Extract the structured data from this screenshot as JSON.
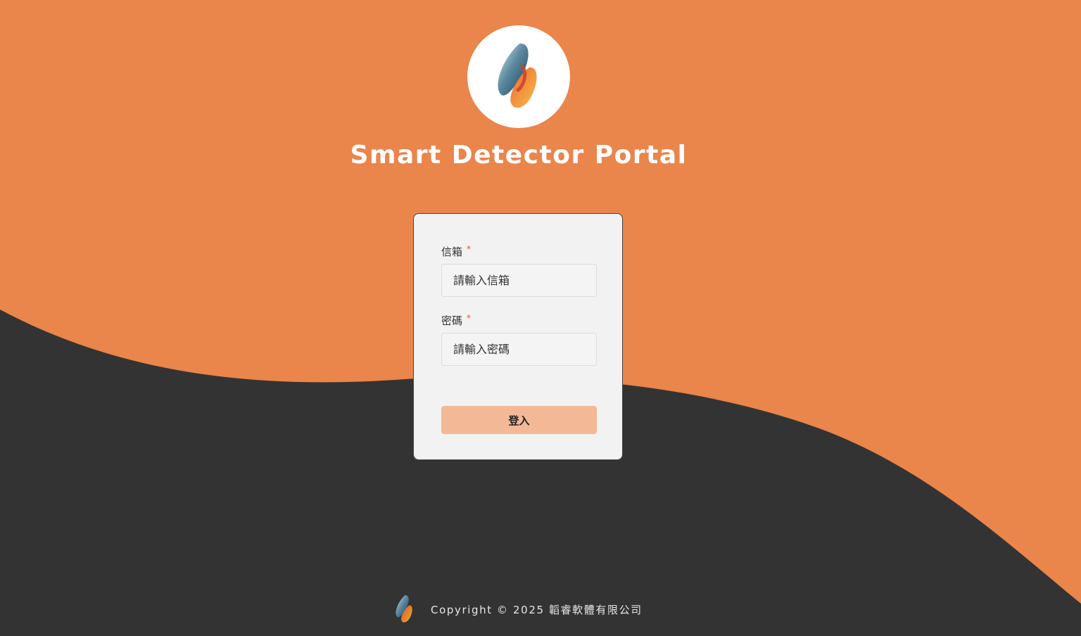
{
  "app": {
    "title": "Smart Detector Portal",
    "logo_icon": "dual-leaf-logo-icon"
  },
  "form": {
    "email": {
      "label": "信箱",
      "required_mark": "*",
      "placeholder": "請輸入信箱",
      "value": ""
    },
    "password": {
      "label": "密碼",
      "required_mark": "*",
      "placeholder": "請輸入密碼",
      "value": ""
    },
    "submit_label": "登入"
  },
  "footer": {
    "copyright": "Copyright © 2025 韜睿軟體有限公司",
    "logo_icon": "dual-leaf-logo-icon"
  },
  "colors": {
    "background_orange": "#ea854b",
    "background_dark": "#333333",
    "card_background": "#f2f2f2",
    "button_background": "#f3b896",
    "required_red": "#e5543a"
  }
}
